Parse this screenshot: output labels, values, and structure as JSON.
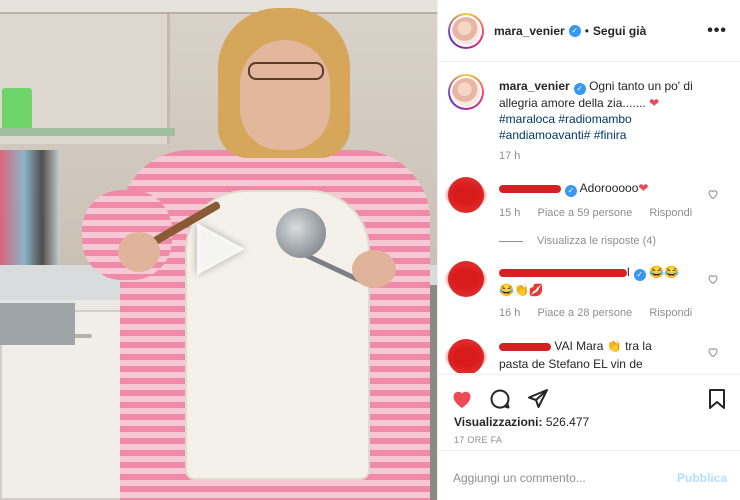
{
  "post": {
    "username": "mara_venier",
    "follow_separator": "•",
    "follow_label": "Segui già",
    "more_icon": "more-horizontal-icon",
    "verified_icon": "verified-badge-icon"
  },
  "caption": {
    "username": "mara_venier",
    "text": "Ogni tanto un po' di allegria amore della zia.......",
    "heart": "❤",
    "hashtags_line1": "#maraloca #radiomambo",
    "hashtags_line2": "#andiamoavanti# #finira",
    "time": "17 h"
  },
  "comments": [
    {
      "text": "Adorooooo",
      "emoji": "❤",
      "time": "15 h",
      "likes": "Piace a 59 persone",
      "reply": "Rispondi"
    },
    {
      "text_end": "l",
      "emoji_line1": "😂😂",
      "emoji_line2": "😂👏💋",
      "time": "16 h",
      "likes": "Piace a 28 persone",
      "reply": "Rispondi"
    },
    {
      "text_line1": "VAI Mara 👏 tra la",
      "text_line2": "pasta de Stefano EL vin de"
    }
  ],
  "view_replies": "Visualizza le risposte (4)",
  "actions": {
    "views_label": "Visualizzazioni:",
    "views_count": "526.477",
    "time_ago": "17 ORE FA"
  },
  "add_comment": {
    "placeholder": "Aggiungi un commento...",
    "publish": "Pubblica"
  },
  "colors": {
    "heart_red": "#ed4956",
    "link_blue": "#00376b",
    "verified_blue": "#3897f0",
    "publish_disabled": "#b2dffc"
  }
}
